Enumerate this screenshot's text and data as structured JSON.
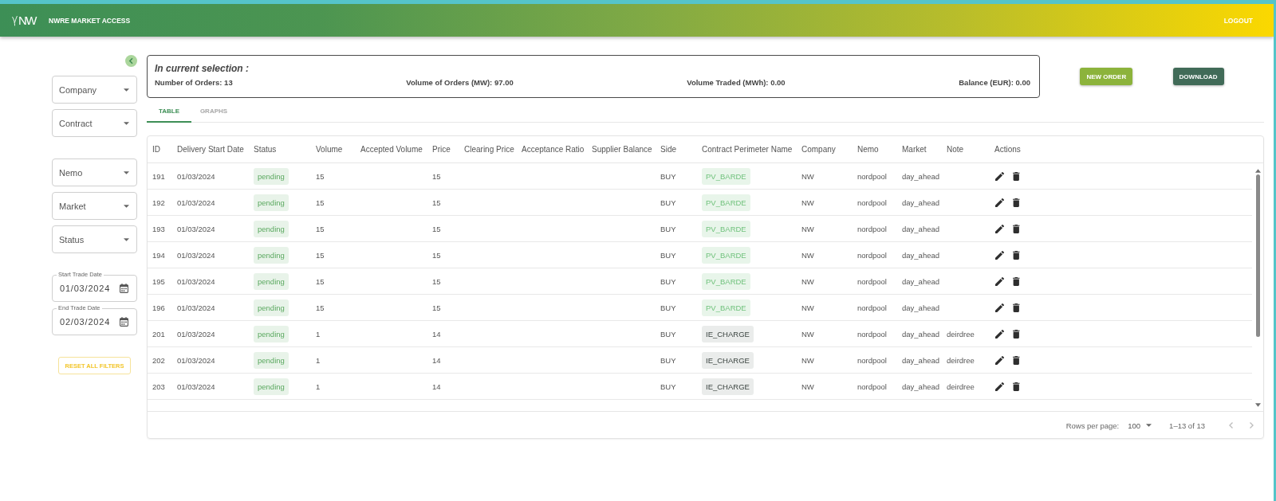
{
  "header": {
    "logo_text": "NW",
    "title": "NWRE MARKET ACCESS",
    "logout": "LOGOUT"
  },
  "sidebar": {
    "filter_groups": [
      [
        {
          "kind": "select",
          "label": "Company"
        },
        {
          "kind": "select",
          "label": "Contract"
        }
      ],
      [
        {
          "kind": "select",
          "label": "Nemo"
        },
        {
          "kind": "select",
          "label": "Market"
        },
        {
          "kind": "select",
          "label": "Status"
        }
      ],
      [
        {
          "kind": "date",
          "label": "Start Trade Date",
          "value": "01/03/2024"
        },
        {
          "kind": "date",
          "label": "End Trade Date",
          "value": "02/03/2024"
        }
      ]
    ],
    "reset_button": "RESET ALL FILTERS"
  },
  "summary": {
    "title": "In current selection :",
    "stats": [
      {
        "label": "Number of Orders:",
        "value": "13"
      },
      {
        "label": "Volume of Orders (MW):",
        "value": "97.00"
      },
      {
        "label": "Volume Traded (MWh):",
        "value": "0.00"
      },
      {
        "label": "Balance (EUR):",
        "value": "0.00"
      }
    ]
  },
  "buttons": [
    {
      "kind": "primary",
      "label": "NEW ORDER"
    },
    {
      "kind": "secondary",
      "label": "DOWNLOAD"
    }
  ],
  "tabs": [
    {
      "label": "TABLE",
      "selected": true
    },
    {
      "label": "GRAPHS",
      "selected": false
    }
  ],
  "table": {
    "columns": [
      "ID",
      "Delivery Start Date",
      "Status",
      "Volume",
      "Accepted Volume",
      "Price",
      "Clearing Price",
      "Acceptance Ratio",
      "Supplier Balance",
      "Side",
      "Contract Perimeter Name",
      "Company",
      "Nemo",
      "Market",
      "Note",
      "Actions"
    ],
    "rows": [
      {
        "id": "191",
        "delivery_start_date": "01/03/2024",
        "status": "pending",
        "volume": "15",
        "price": "15",
        "side": "BUY",
        "contract": {
          "label": "PV_BARDE",
          "color": "#e8f5ea"
        },
        "company": "NW",
        "nemo": "nordpool",
        "market": "day_ahead"
      },
      {
        "id": "192",
        "delivery_start_date": "01/03/2024",
        "status": "pending",
        "volume": "15",
        "price": "15",
        "side": "BUY",
        "contract": {
          "label": "PV_BARDE",
          "color": "#e8f5ea"
        },
        "company": "NW",
        "nemo": "nordpool",
        "market": "day_ahead"
      },
      {
        "id": "193",
        "delivery_start_date": "01/03/2024",
        "status": "pending",
        "volume": "15",
        "price": "15",
        "side": "BUY",
        "contract": {
          "label": "PV_BARDE",
          "color": "#e8f5ea"
        },
        "company": "NW",
        "nemo": "nordpool",
        "market": "day_ahead"
      },
      {
        "id": "194",
        "delivery_start_date": "01/03/2024",
        "status": "pending",
        "volume": "15",
        "price": "15",
        "side": "BUY",
        "contract": {
          "label": "PV_BARDE",
          "color": "#e8f5ea"
        },
        "company": "NW",
        "nemo": "nordpool",
        "market": "day_ahead"
      },
      {
        "id": "195",
        "delivery_start_date": "01/03/2024",
        "status": "pending",
        "volume": "15",
        "price": "15",
        "side": "BUY",
        "contract": {
          "label": "PV_BARDE",
          "color": "#e8f5ea"
        },
        "company": "NW",
        "nemo": "nordpool",
        "market": "day_ahead"
      },
      {
        "id": "196",
        "delivery_start_date": "01/03/2024",
        "status": "pending",
        "volume": "15",
        "price": "15",
        "side": "BUY",
        "contract": {
          "label": "PV_BARDE",
          "color": "#e8f5ea"
        },
        "company": "NW",
        "nemo": "nordpool",
        "market": "day_ahead"
      },
      {
        "id": "201",
        "delivery_start_date": "01/03/2024",
        "status": "pending",
        "volume": "1",
        "price": "14",
        "side": "BUY",
        "contract": {
          "label": "IE_CHARGE",
          "color": "#eaeceb"
        },
        "company": "NW",
        "nemo": "nordpool",
        "market": "day_ahead",
        "note": "deirdree"
      },
      {
        "id": "202",
        "delivery_start_date": "01/03/2024",
        "status": "pending",
        "volume": "1",
        "price": "14",
        "side": "BUY",
        "contract": {
          "label": "IE_CHARGE",
          "color": "#eaeceb"
        },
        "company": "NW",
        "nemo": "nordpool",
        "market": "day_ahead",
        "note": "deirdree"
      },
      {
        "id": "203",
        "delivery_start_date": "01/03/2024",
        "status": "pending",
        "volume": "1",
        "price": "14",
        "side": "BUY",
        "contract": {
          "label": "IE_CHARGE",
          "color": "#eaeceb"
        },
        "company": "NW",
        "nemo": "nordpool",
        "market": "day_ahead",
        "note": "deirdree"
      }
    ]
  },
  "pagination": {
    "rows_per_page_label": "Rows per page:",
    "rows_per_page": "100",
    "range": "1–13 of 13",
    "prev_page": {
      "disabled": true
    },
    "next_page": {
      "disabled": true
    }
  }
}
